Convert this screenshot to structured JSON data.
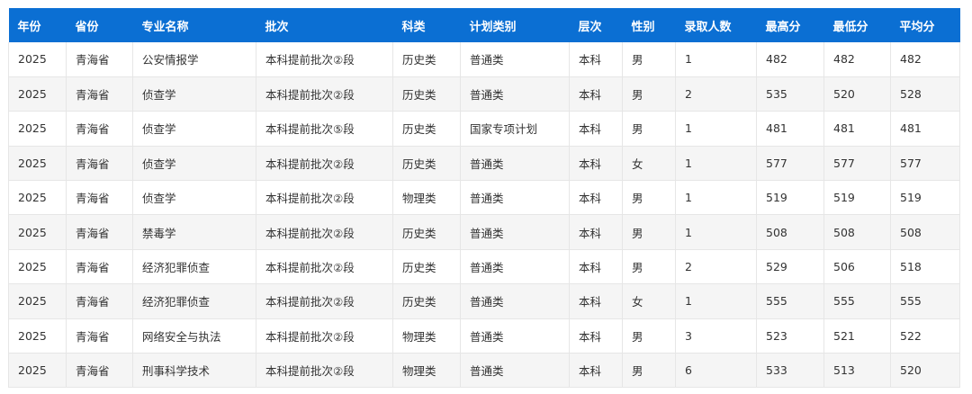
{
  "table": {
    "columns": [
      "年份",
      "省份",
      "专业名称",
      "批次",
      "科类",
      "计划类别",
      "层次",
      "性别",
      "录取人数",
      "最高分",
      "最低分",
      "平均分"
    ],
    "rows": [
      [
        "2025",
        "青海省",
        "公安情报学",
        "本科提前批次②段",
        "历史类",
        "普通类",
        "本科",
        "男",
        "1",
        "482",
        "482",
        "482"
      ],
      [
        "2025",
        "青海省",
        "侦查学",
        "本科提前批次②段",
        "历史类",
        "普通类",
        "本科",
        "男",
        "2",
        "535",
        "520",
        "528"
      ],
      [
        "2025",
        "青海省",
        "侦查学",
        "本科提前批次⑤段",
        "历史类",
        "国家专项计划",
        "本科",
        "男",
        "1",
        "481",
        "481",
        "481"
      ],
      [
        "2025",
        "青海省",
        "侦查学",
        "本科提前批次②段",
        "历史类",
        "普通类",
        "本科",
        "女",
        "1",
        "577",
        "577",
        "577"
      ],
      [
        "2025",
        "青海省",
        "侦查学",
        "本科提前批次②段",
        "物理类",
        "普通类",
        "本科",
        "男",
        "1",
        "519",
        "519",
        "519"
      ],
      [
        "2025",
        "青海省",
        "禁毒学",
        "本科提前批次②段",
        "历史类",
        "普通类",
        "本科",
        "男",
        "1",
        "508",
        "508",
        "508"
      ],
      [
        "2025",
        "青海省",
        "经济犯罪侦查",
        "本科提前批次②段",
        "历史类",
        "普通类",
        "本科",
        "男",
        "2",
        "529",
        "506",
        "518"
      ],
      [
        "2025",
        "青海省",
        "经济犯罪侦查",
        "本科提前批次②段",
        "历史类",
        "普通类",
        "本科",
        "女",
        "1",
        "555",
        "555",
        "555"
      ],
      [
        "2025",
        "青海省",
        "网络安全与执法",
        "本科提前批次②段",
        "物理类",
        "普通类",
        "本科",
        "男",
        "3",
        "523",
        "521",
        "522"
      ],
      [
        "2025",
        "青海省",
        "刑事科学技术",
        "本科提前批次②段",
        "物理类",
        "普通类",
        "本科",
        "男",
        "6",
        "533",
        "513",
        "520"
      ]
    ]
  },
  "colors": {
    "header_bg": "#0b6fd3",
    "header_text": "#ffffff",
    "row_alt_bg": "#f5f5f5",
    "border": "#e6e6e6",
    "cell_text": "#333333"
  }
}
